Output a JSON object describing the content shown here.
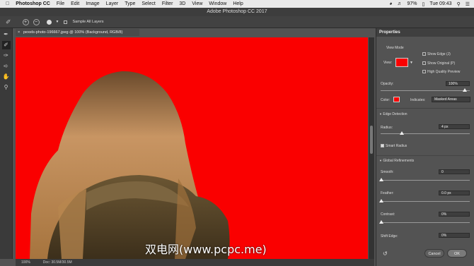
{
  "menubar": {
    "app": "Photoshop CC",
    "items": [
      "File",
      "Edit",
      "Image",
      "Layer",
      "Type",
      "Select",
      "Filter",
      "3D",
      "View",
      "Window",
      "Help"
    ],
    "battery": "97%",
    "clock": "Tue 09:43"
  },
  "window_title": "Adobe Photoshop CC 2017",
  "options": {
    "sample_all_layers": "Sample All Layers"
  },
  "document_tab": "pexels-photo-196667.jpeg @ 100% (Background, RGB/8)",
  "status": {
    "zoom": "100%",
    "doc": "Doc: 30.5M/30.5M"
  },
  "panel": {
    "title": "Properties",
    "view_mode_label": "View Mode",
    "view_label": "View:",
    "show_edge": "Show Edge (J)",
    "show_original": "Show Original (P)",
    "high_quality_preview": "High Quality Preview",
    "opacity_label": "Opacity:",
    "opacity_value": "100%",
    "color_label": "Color:",
    "indicates_label": "Indicates:",
    "indicates_value": "Masked Areas",
    "edge_detection": "Edge Detection",
    "radius_label": "Radius:",
    "radius_value": "4 px",
    "smart_radius": "Smart Radius",
    "global_refinements": "Global Refinements",
    "smooth_label": "Smooth:",
    "smooth_value": "0",
    "feather_label": "Feather:",
    "feather_value": "0.0 px",
    "contrast_label": "Contrast:",
    "contrast_value": "0%",
    "shift_edge_label": "Shift Edge:",
    "shift_edge_value": "0%",
    "cancel": "Cancel",
    "ok": "OK"
  },
  "overlay_color": "#fa0000",
  "watermark": "双电网(www.pcpc.me)"
}
